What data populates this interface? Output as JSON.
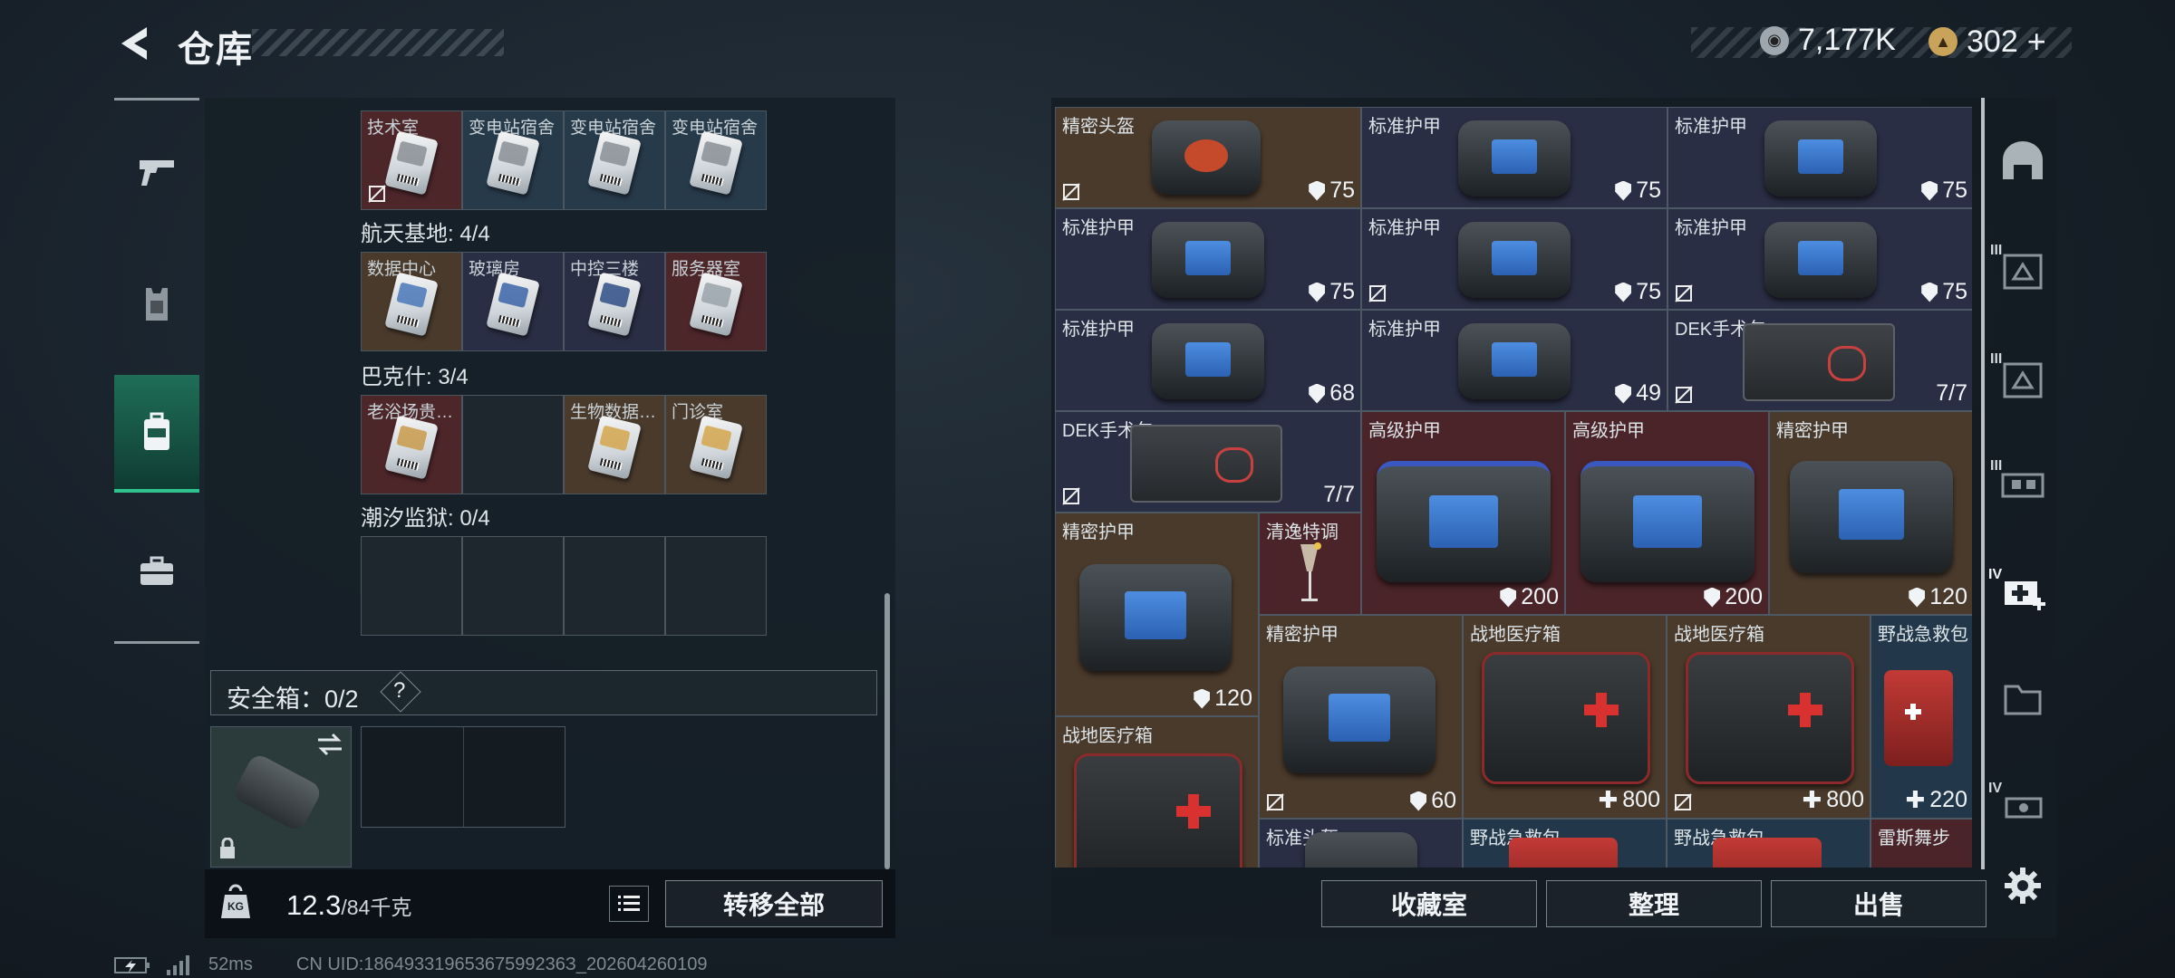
{
  "header": {
    "title": "仓库"
  },
  "currency": [
    {
      "icon": "silver-coin-icon",
      "value": "7,177K"
    },
    {
      "icon": "gold-coin-icon",
      "value": "302"
    },
    {
      "plus": "+"
    }
  ],
  "left_nav": [
    {
      "icon": "pistol-icon"
    },
    {
      "icon": "armor-vest-icon"
    },
    {
      "icon": "backpack-icon",
      "active": true
    },
    {
      "icon": "briefcase-icon"
    }
  ],
  "key_rows": [
    {
      "cells": [
        "技术室",
        "变电站宿舍",
        "变电站宿舍",
        "变电站宿舍"
      ],
      "colors": [
        "red",
        "blue",
        "blue",
        "blue"
      ]
    },
    {
      "section": "航天基地: 4/4",
      "cells": [
        "数据中心",
        "玻璃房",
        "中控三楼",
        "服务器室"
      ],
      "colors": [
        "brown",
        "navy",
        "navy",
        "red"
      ]
    },
    {
      "section": "巴克什: 3/4",
      "cells": [
        "老浴场贵…",
        "",
        "生物数据…",
        "门诊室"
      ],
      "colors": [
        "red",
        "empty",
        "brown",
        "brown"
      ]
    },
    {
      "section": "潮汐监狱: 0/4",
      "cells": [
        "",
        "",
        "",
        ""
      ],
      "colors": [
        "empty",
        "empty",
        "empty",
        "empty"
      ]
    }
  ],
  "safe_box": {
    "label": "安全箱：0/2",
    "help": "?"
  },
  "weight": {
    "current": "12.3",
    "max": "/84千克",
    "kg": "KG"
  },
  "transfer_all": "转移全部",
  "items": [
    {
      "name": "精密头盔",
      "value": "75"
    },
    {
      "name": "标准护甲",
      "value": "75"
    },
    {
      "name": "标准护甲",
      "value": "75"
    },
    {
      "name": "标准护甲",
      "value": "75"
    },
    {
      "name": "标准护甲",
      "value": "75"
    },
    {
      "name": "标准护甲",
      "value": "75"
    },
    {
      "name": "标准护甲",
      "value": "68"
    },
    {
      "name": "标准护甲",
      "value": "49"
    },
    {
      "name": "DEK手术包",
      "value": "7/7"
    },
    {
      "name": "DEK手术包",
      "value": "7/7"
    },
    {
      "name": "高级护甲",
      "value": "200"
    },
    {
      "name": "高级护甲",
      "value": "200"
    },
    {
      "name": "精密护甲",
      "value": "120"
    },
    {
      "name": "精密护甲",
      "value": "120"
    },
    {
      "name": "清逸特调",
      "value": ""
    },
    {
      "name": "精密护甲",
      "value": "60"
    },
    {
      "name": "战地医疗箱",
      "value": "800"
    },
    {
      "name": "战地医疗箱",
      "value": "800"
    },
    {
      "name": "野战急救包",
      "value": "220"
    },
    {
      "name": "战地医疗箱",
      "value": ""
    },
    {
      "name": "标准头盔",
      "value": ""
    },
    {
      "name": "野战急救包",
      "value": ""
    },
    {
      "name": "野战急救包",
      "value": ""
    },
    {
      "name": "雷斯舞步",
      "value": ""
    }
  ],
  "actions": {
    "collection": "收藏室",
    "sort": "整理",
    "sell": "出售"
  },
  "right_tabs": [
    "helmet-tab-icon",
    "tier-III-armor-icon",
    "tier-III-armor-icon",
    "tier-III-rig-icon",
    "tier-IV-medkit-icon",
    "folder-icon",
    "tier-IV-weapon-icon",
    "settings-icon"
  ],
  "right_tab_labels": {
    "t1": "III",
    "t2": "III",
    "t3": "III",
    "t4": "IV",
    "t6": "IV"
  },
  "footer": {
    "ping": "52ms",
    "uid": "CN UID:18649331965367599236З_202604260109"
  }
}
